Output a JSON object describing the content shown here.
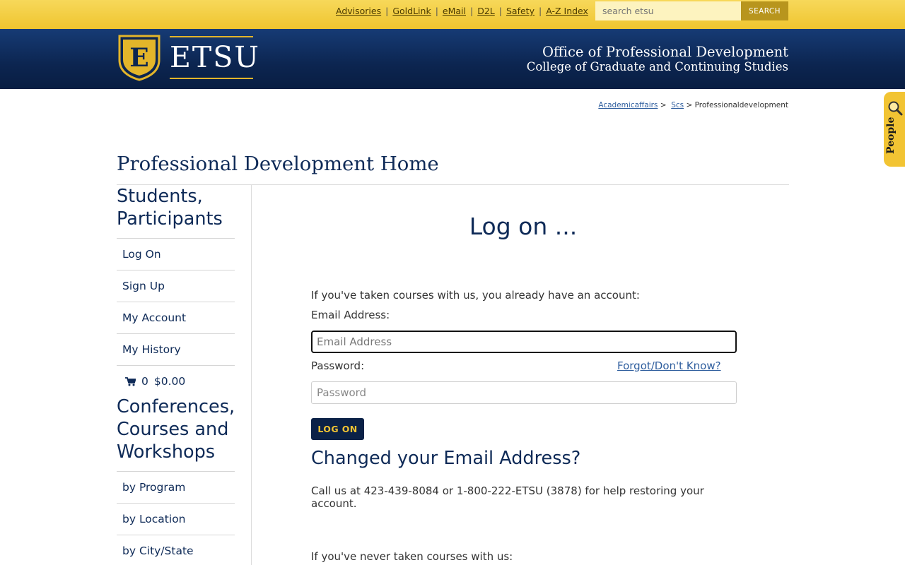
{
  "utility": {
    "links": [
      "Advisories",
      "GoldLink",
      "eMail",
      "D2L",
      "Safety",
      "A-Z Index"
    ],
    "search_placeholder": "search etsu",
    "search_button": "SEARCH"
  },
  "header": {
    "logo_letter": "E",
    "logo_word": "ETSU",
    "dept_line1": "Office of Professional Development",
    "dept_line2": "College of Graduate and Continuing Studies"
  },
  "breadcrumb": {
    "items": [
      "Academicaffairs",
      "Scs"
    ],
    "current": "Professionaldevelopment"
  },
  "people_tab": {
    "label": "People"
  },
  "page_title": "Professional Development Home",
  "sidebar": {
    "heading1": "Students, Participants",
    "items1": [
      "Log On",
      "Sign Up",
      "My Account",
      "My History"
    ],
    "cart": {
      "count": "0",
      "total": "$0.00"
    },
    "heading2": "Conferences, Courses and Workshops",
    "items2": [
      "by Program",
      "by Location",
      "by City/State"
    ]
  },
  "main": {
    "heading": "Log on ...",
    "intro": "If you've taken courses with us, you already have an account:",
    "email_label": "Email Address:",
    "email_placeholder": "Email Address",
    "password_label": "Password:",
    "forgot_link": "Forgot/Don't Know?",
    "password_placeholder": "Password",
    "logon_button": "LOG ON",
    "changed_heading": "Changed your Email Address?",
    "call_text": "Call us at 423-439-8084 or 1-800-222-ETSU (3878) for help restoring your account.",
    "never_text": "If you've never taken courses with us:"
  },
  "colors": {
    "gold": "#f2c433",
    "navy": "#0e2a57",
    "link": "#2f5e9e"
  }
}
